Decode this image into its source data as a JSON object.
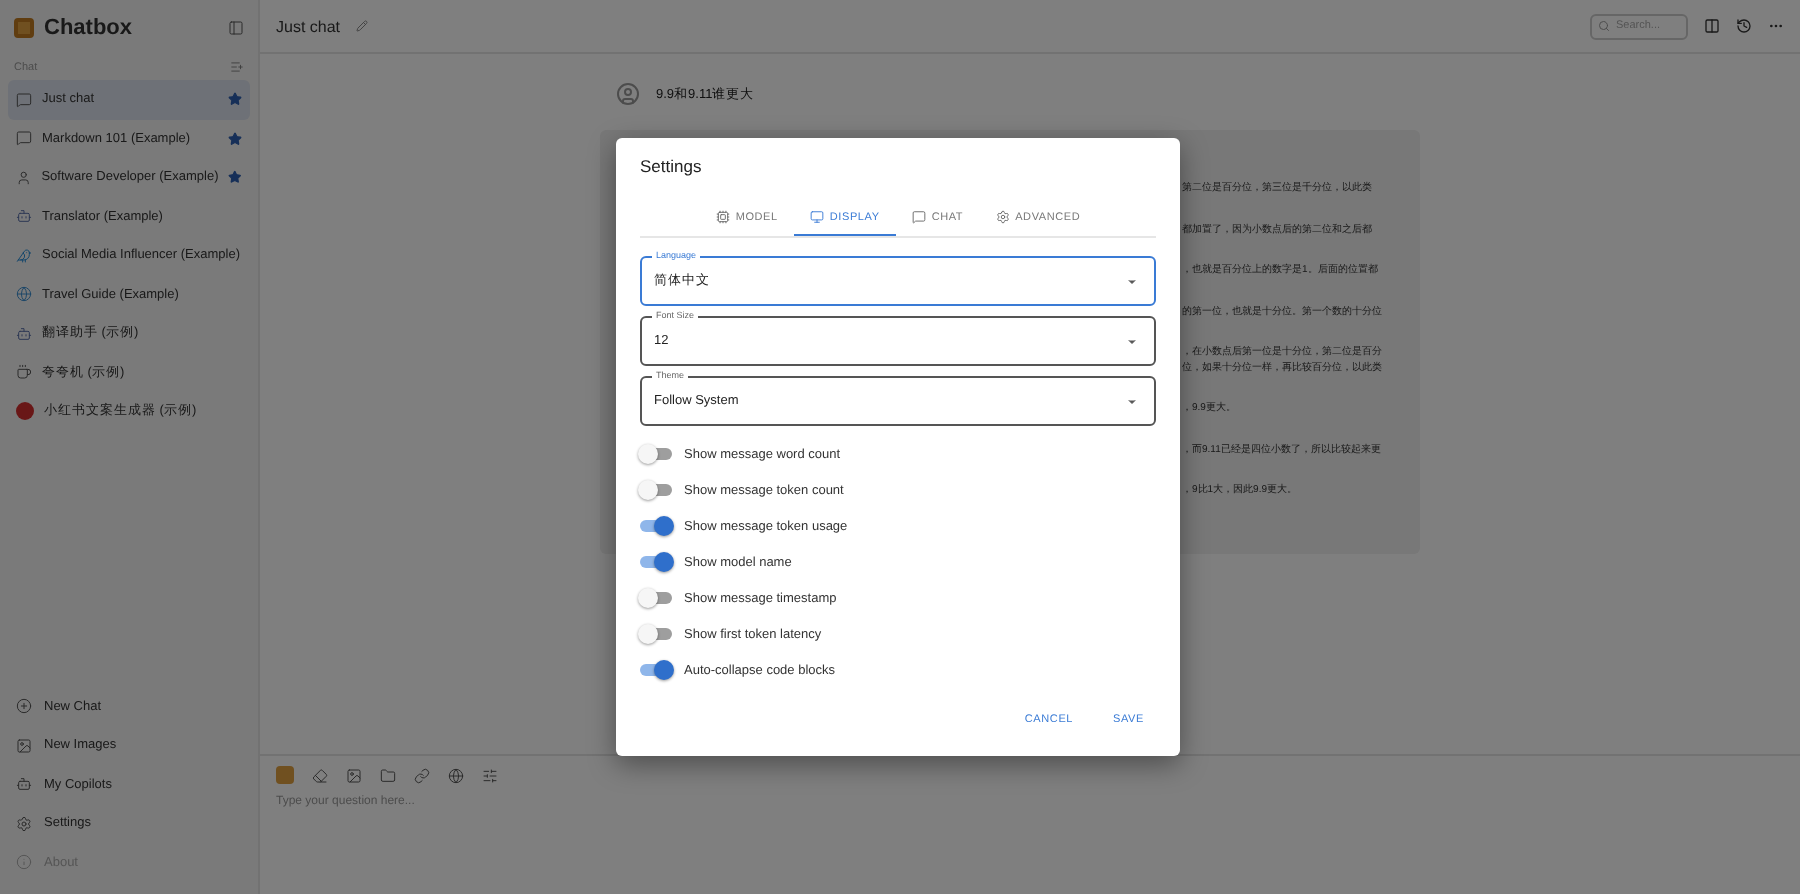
{
  "app": {
    "name": "Chatbox"
  },
  "sidebar": {
    "section": "Chat",
    "items": [
      {
        "label": "Just chat",
        "kind": "chat",
        "starred": true,
        "selected": true
      },
      {
        "label": "Markdown 101 (Example)",
        "kind": "chat",
        "starred": true,
        "selected": false
      },
      {
        "label": "Software Developer (Example)",
        "kind": "person",
        "starred": true,
        "selected": false
      },
      {
        "label": "Translator (Example)",
        "kind": "robot",
        "starred": false,
        "selected": false
      },
      {
        "label": "Social Media Influencer (Example)",
        "kind": "bird",
        "starred": false,
        "selected": false
      },
      {
        "label": "Travel Guide (Example)",
        "kind": "globe",
        "starred": false,
        "selected": false
      },
      {
        "label": "翻译助手 (示例)",
        "kind": "robot",
        "starred": false,
        "selected": false
      },
      {
        "label": "夸夸机 (示例)",
        "kind": "cup",
        "starred": false,
        "selected": false
      },
      {
        "label": "小红书文案生成器 (示例)",
        "kind": "red",
        "starred": false,
        "selected": false
      }
    ],
    "actions": [
      {
        "label": "New Chat",
        "kind": "plus",
        "disabled": false
      },
      {
        "label": "New Images",
        "kind": "image",
        "disabled": false
      },
      {
        "label": "My Copilots",
        "kind": "robot",
        "disabled": false
      },
      {
        "label": "Settings",
        "kind": "gear",
        "disabled": false
      },
      {
        "label": "About",
        "kind": "info",
        "disabled": true
      }
    ]
  },
  "header": {
    "title": "Just chat",
    "search_placeholder": "Search..."
  },
  "chat": {
    "question": "9.9和9.11谁更大",
    "answer_lines": [
      "第二位是百分位，第三位是千分位，以此类",
      "都加置了，因为小数点后的第二位和之后都",
      "，也就是百分位上的数字是1。后面的位置都",
      "的第一位，也就是十分位。第一个数的十分位",
      "，在小数点后第一位是十分位，第二位是百分",
      "位，如果十分位一样，再比较百分位，以此类",
      "，9.9更大。",
      "，而9.11已经是四位小数了，所以比较起来更",
      "，9比1大，因此9.9更大。"
    ]
  },
  "input": {
    "placeholder": "Type your question here..."
  },
  "dialog": {
    "title": "Settings",
    "tabs": [
      {
        "label": "MODEL",
        "kind": "model",
        "selected": false
      },
      {
        "label": "DISPLAY",
        "kind": "display",
        "selected": true
      },
      {
        "label": "CHAT",
        "kind": "chat",
        "selected": false
      },
      {
        "label": "ADVANCED",
        "kind": "gear",
        "selected": false
      }
    ],
    "selects": [
      {
        "label": "Language",
        "value": "简体中文",
        "focused": true
      },
      {
        "label": "Font Size",
        "value": "12",
        "focused": false
      },
      {
        "label": "Theme",
        "value": "Follow System",
        "focused": false
      }
    ],
    "switches": [
      {
        "label": "Show message word count",
        "on": false
      },
      {
        "label": "Show message token count",
        "on": false
      },
      {
        "label": "Show message token usage",
        "on": true
      },
      {
        "label": "Show model name",
        "on": true
      },
      {
        "label": "Show message timestamp",
        "on": false
      },
      {
        "label": "Show first token latency",
        "on": false
      },
      {
        "label": "Auto-collapse code blocks",
        "on": true
      }
    ],
    "buttons": [
      "CANCEL",
      "SAVE"
    ]
  }
}
